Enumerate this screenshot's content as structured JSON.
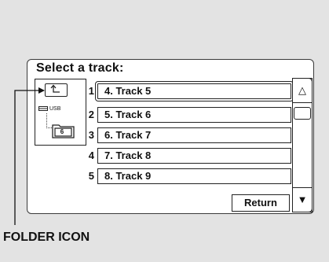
{
  "screen": {
    "title": "Select a track:"
  },
  "folder_panel": {
    "device_label": "USB",
    "folder_number": "6"
  },
  "tracks": [
    {
      "number": "1",
      "label": "4. Track 5",
      "selected": true
    },
    {
      "number": "2",
      "label": "5. Track 6",
      "selected": false
    },
    {
      "number": "3",
      "label": "6. Track 7",
      "selected": false
    },
    {
      "number": "4",
      "label": "7. Track 8",
      "selected": false
    },
    {
      "number": "5",
      "label": "8. Track 9",
      "selected": false
    }
  ],
  "buttons": {
    "return_label": "Return",
    "scroll_up_glyph": "△",
    "scroll_down_glyph": "▼"
  },
  "callout": {
    "label": "FOLDER ICON"
  },
  "icons": [
    "folder-up-icon",
    "usb-drive-icon",
    "folder-icon",
    "scroll-up-icon",
    "scroll-down-icon"
  ]
}
